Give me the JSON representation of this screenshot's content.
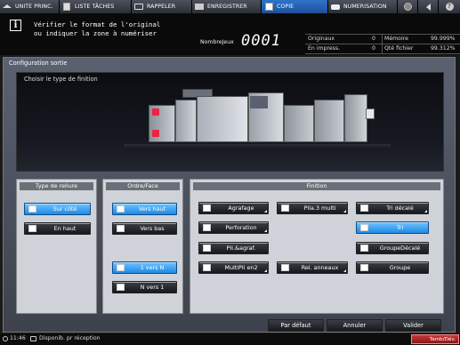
{
  "tabs": [
    {
      "label": "UNITE PRINC.",
      "icon": "home-icon",
      "active": false
    },
    {
      "label": "LISTE TÂCHES",
      "icon": "job-list-icon",
      "active": false
    },
    {
      "label": "RAPPELER",
      "icon": "recall-icon",
      "active": false
    },
    {
      "label": "ENREGISTRER",
      "icon": "save-icon",
      "active": false
    },
    {
      "label": "COPIE",
      "icon": "copy-icon",
      "active": true
    },
    {
      "label": "NUMERISATION",
      "icon": "scan-icon",
      "active": false
    }
  ],
  "header": {
    "message_line1": "Vérifier le format de l'original",
    "message_line2": "ou indiquer la zone à numériser",
    "nombre_jeux_label": "NombreJeux",
    "nombre_jeux_value": "0001",
    "stats": {
      "originaux_label": "Originaux",
      "originaux_value": "0",
      "memoire_label": "Mémoire",
      "memoire_value": "99.999%",
      "en_impress_label": "En impress.",
      "en_impress_value": "0",
      "qte_fichier_label": "Qté fichier",
      "qte_fichier_value": "99.312%"
    }
  },
  "main": {
    "title": "Configuration sortie",
    "preview_title": "Choisir le type de finition"
  },
  "type_reliure": {
    "header": "Type de reliure",
    "buttons": [
      {
        "label": "Sur côté",
        "selected": true
      },
      {
        "label": "En haut",
        "selected": false
      }
    ]
  },
  "ordre_face": {
    "header": "Ordre/Face",
    "buttons": [
      {
        "label": "Vers haut",
        "selected": true
      },
      {
        "label": "Vers bas",
        "selected": false
      },
      {
        "label": "1 vers N",
        "selected": true
      },
      {
        "label": "N vers 1",
        "selected": false
      }
    ]
  },
  "finition": {
    "header": "Finition",
    "buttons": [
      {
        "label": "Agrafage",
        "selected": false
      },
      {
        "label": "Plia.3 multi",
        "selected": false
      },
      {
        "label": "Tri décalé",
        "selected": false
      },
      {
        "label": "Perforation",
        "selected": false
      },
      {
        "label": "Tri",
        "selected": true
      },
      {
        "label": "Pli.&agraf.",
        "selected": false
      },
      {
        "label": "GroupeDécalé",
        "selected": false
      },
      {
        "label": "MultiPli en2",
        "selected": false
      },
      {
        "label": "Rel. anneaux",
        "selected": false
      },
      {
        "label": "Groupe",
        "selected": false
      }
    ]
  },
  "footer": {
    "par_defaut": "Par défaut",
    "annuler": "Annuler",
    "valider": "Valider"
  },
  "status": {
    "time": "11:46",
    "reception": "Disponib. pr réception",
    "tamb": "Tamb/Dév."
  },
  "colors": {
    "accent": "#1f8ae6",
    "active_tab": "#2f74c9",
    "alert": "#c83a3a"
  }
}
